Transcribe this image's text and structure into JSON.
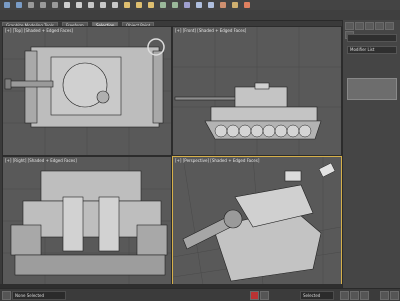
{
  "toolbar": {
    "tabs": [
      {
        "label": "Graphite Modeling Tools",
        "active": false
      },
      {
        "label": "Freeform",
        "active": false
      },
      {
        "label": "Selection",
        "active": true
      },
      {
        "label": "Object Paint",
        "active": false
      }
    ],
    "icons": [
      "undo-icon",
      "redo-icon",
      "link-icon",
      "unlink-icon",
      "bind-icon",
      "select-icon",
      "region-icon",
      "move-icon",
      "rotate-icon",
      "scale-icon",
      "snap-icon",
      "angle-snap-icon",
      "percent-snap-icon",
      "mirror-icon",
      "align-icon",
      "layer-icon",
      "curve-editor-icon",
      "schematic-icon",
      "material-editor-icon",
      "render-setup-icon",
      "render-icon"
    ]
  },
  "viewports": {
    "top": {
      "label": "[+] [Top] [Shaded + Edged Faces]"
    },
    "front": {
      "label": "[+] [Front] [Shaded + Edged Faces]"
    },
    "right": {
      "label": "[+] [Right] [Shaded + Edged Faces]"
    },
    "perspective": {
      "label": "[+] [Perspective] [Shaded + Edged Faces]"
    }
  },
  "command_panel": {
    "name_field": "Modifier List",
    "object_name": "",
    "tabs": [
      "create-tab",
      "modify-tab",
      "hierarchy-tab",
      "motion-tab",
      "display-tab",
      "utilities-tab"
    ]
  },
  "status": {
    "selection": "None Selected",
    "set_key": "Selected",
    "accent_red": "#b33333",
    "active_border": "#d6b04a"
  }
}
